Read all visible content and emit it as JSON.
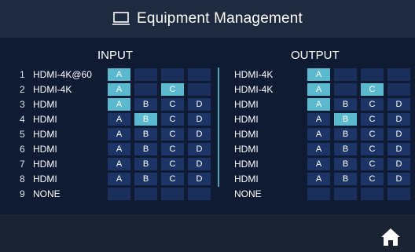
{
  "header": {
    "title": "Equipment Management",
    "icon": "monitor-icon"
  },
  "input": {
    "heading": "INPUT"
  },
  "output": {
    "heading": "OUTPUT"
  },
  "rows": [
    {
      "num": "1",
      "input_name": "HDMI-4K@60",
      "output_name": "HDMI-4K",
      "input_slots": [
        "A",
        "",
        "",
        ""
      ],
      "input_active": [
        true,
        false,
        false,
        false
      ],
      "output_slots": [
        "A",
        "",
        "",
        ""
      ],
      "output_active": [
        true,
        false,
        false,
        false
      ]
    },
    {
      "num": "2",
      "input_name": "HDMI-4K",
      "output_name": "HDMI-4K",
      "input_slots": [
        "A",
        "",
        "C",
        ""
      ],
      "input_active": [
        true,
        false,
        true,
        false
      ],
      "output_slots": [
        "A",
        "",
        "C",
        ""
      ],
      "output_active": [
        true,
        false,
        true,
        false
      ]
    },
    {
      "num": "3",
      "input_name": "HDMI",
      "output_name": "HDMI",
      "input_slots": [
        "A",
        "B",
        "C",
        "D"
      ],
      "input_active": [
        true,
        false,
        false,
        false
      ],
      "output_slots": [
        "A",
        "B",
        "C",
        "D"
      ],
      "output_active": [
        true,
        false,
        false,
        false
      ]
    },
    {
      "num": "4",
      "input_name": "HDMI",
      "output_name": "HDMI",
      "input_slots": [
        "A",
        "B",
        "C",
        "D"
      ],
      "input_active": [
        false,
        true,
        false,
        false
      ],
      "output_slots": [
        "A",
        "B",
        "C",
        "D"
      ],
      "output_active": [
        false,
        true,
        false,
        false
      ]
    },
    {
      "num": "5",
      "input_name": "HDMI",
      "output_name": "HDMI",
      "input_slots": [
        "A",
        "B",
        "C",
        "D"
      ],
      "input_active": [
        false,
        false,
        false,
        false
      ],
      "output_slots": [
        "A",
        "B",
        "C",
        "D"
      ],
      "output_active": [
        false,
        false,
        false,
        false
      ]
    },
    {
      "num": "6",
      "input_name": "HDMI",
      "output_name": "HDMI",
      "input_slots": [
        "A",
        "B",
        "C",
        "D"
      ],
      "input_active": [
        false,
        false,
        false,
        false
      ],
      "output_slots": [
        "A",
        "B",
        "C",
        "D"
      ],
      "output_active": [
        false,
        false,
        false,
        false
      ]
    },
    {
      "num": "7",
      "input_name": "HDMI",
      "output_name": "HDMI",
      "input_slots": [
        "A",
        "B",
        "C",
        "D"
      ],
      "input_active": [
        false,
        false,
        false,
        false
      ],
      "output_slots": [
        "A",
        "B",
        "C",
        "D"
      ],
      "output_active": [
        false,
        false,
        false,
        false
      ]
    },
    {
      "num": "8",
      "input_name": "HDMI",
      "output_name": "HDMI",
      "input_slots": [
        "A",
        "B",
        "C",
        "D"
      ],
      "input_active": [
        false,
        false,
        false,
        false
      ],
      "output_slots": [
        "A",
        "B",
        "C",
        "D"
      ],
      "output_active": [
        false,
        false,
        false,
        false
      ]
    },
    {
      "num": "9",
      "input_name": "NONE",
      "output_name": "NONE",
      "input_slots": [
        "",
        "",
        "",
        ""
      ],
      "input_active": [
        false,
        false,
        false,
        false
      ],
      "output_slots": [
        "",
        "",
        "",
        ""
      ],
      "output_active": [
        false,
        false,
        false,
        false
      ]
    }
  ],
  "footer": {
    "home_icon": "home-icon"
  },
  "colors": {
    "active": "#5ab9cf",
    "inactive": "#1d3566",
    "background": "#0f1a33",
    "header": "#1e2a40"
  }
}
